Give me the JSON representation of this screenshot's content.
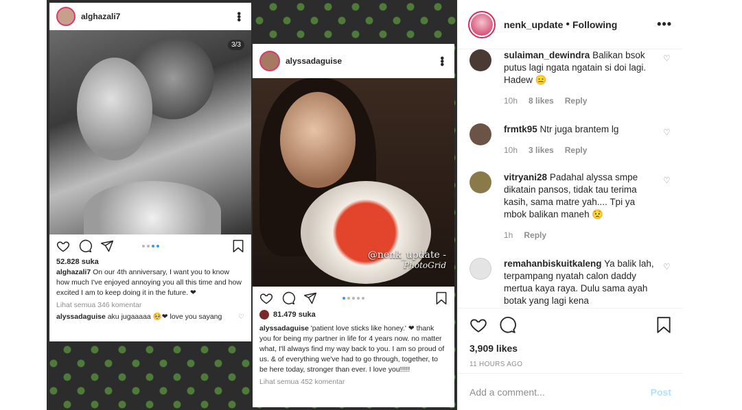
{
  "colors": {
    "accent": "#3897f0",
    "heart": "#e0245e",
    "muted": "#8e8e8e",
    "ring": "#e0245e"
  },
  "post_image": {
    "card1": {
      "username": "alghazali7",
      "counter": "3/3",
      "likes": "52.828 suka",
      "caption_user": "alghazali7",
      "caption_text": "On our 4th anniversary, I want you to know how much I've enjoyed annoying you all this time and how excited I am to keep doing it in the future. ❤",
      "view_comments": "Lihat semua 346 komentar",
      "comment_user": "alyssadaguise",
      "comment_text": "aku jugaaaaa 🥺❤ love you sayang"
    },
    "card2": {
      "username": "alyssadaguise",
      "likes": "81.479 suka",
      "caption_user": "alyssadaguise",
      "caption_text": "'patient love sticks like honey.' ❤ thank you for being my partner in life for 4 years now. no matter what, I'll always find my way back to you. I am so proud of us. & of everything we've had to go through, together, to be here today, stronger than ever. I love you!!!!!",
      "view_comments": "Lihat semua 452 komentar",
      "watermark": "@nenk_update -",
      "watermark2": "PhotoGrid"
    }
  },
  "header": {
    "owner": "nenk_update",
    "separator": "•",
    "follow_state": "Following",
    "more": "•••"
  },
  "comments": [
    {
      "user": "sulaiman_dewindra",
      "text": "Balikan bsok putus lagi ngata ngatain si doi lagi. Hadew 😑",
      "time": "10h",
      "likes": "8 likes",
      "reply": "Reply",
      "avatar_color": "#4a3a34"
    },
    {
      "user": "frmtk95",
      "text": "Ntr juga brantem lg",
      "time": "10h",
      "likes": "3 likes",
      "reply": "Reply",
      "avatar_color": "#6b5446"
    },
    {
      "user": "vitryani28",
      "text": "Padahal alyssa smpe dikatain pansos, tidak tau terima kasih, sama matre yah.... Tpi ya mbok balikan maneh 😟",
      "time": "1h",
      "likes": "",
      "reply": "Reply",
      "avatar_color": "#8a7a4a"
    },
    {
      "user": "remahanbiskuitkaleng",
      "text": "Ya balik lah, terpampang nyatah calon daddy mertua kaya raya. Dulu sama ayah botak yang lagi kena",
      "time": "",
      "likes": "",
      "reply": "",
      "avatar_color": "#dbdbdb"
    }
  ],
  "actions": {
    "likes": "3,909 likes",
    "time_ago": "11 HOURS AGO"
  },
  "comment_box": {
    "placeholder": "Add a comment...",
    "post_label": "Post"
  }
}
